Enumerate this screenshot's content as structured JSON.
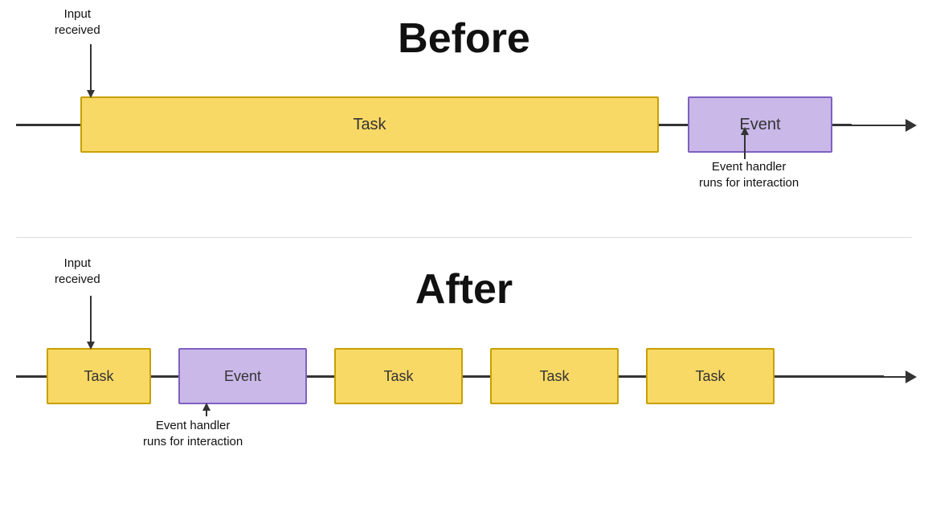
{
  "before": {
    "title": "Before",
    "input_label": "Input\nreceived",
    "task_label": "Task",
    "event_label": "Event",
    "event_handler_label": "Event handler\nruns for interaction"
  },
  "after": {
    "title": "After",
    "input_label": "Input\nreceived",
    "task_label": "Task",
    "event_label": "Event",
    "event_handler_label": "Event handler\nruns for interaction",
    "task2_label": "Task",
    "task3_label": "Task",
    "task4_label": "Task"
  }
}
